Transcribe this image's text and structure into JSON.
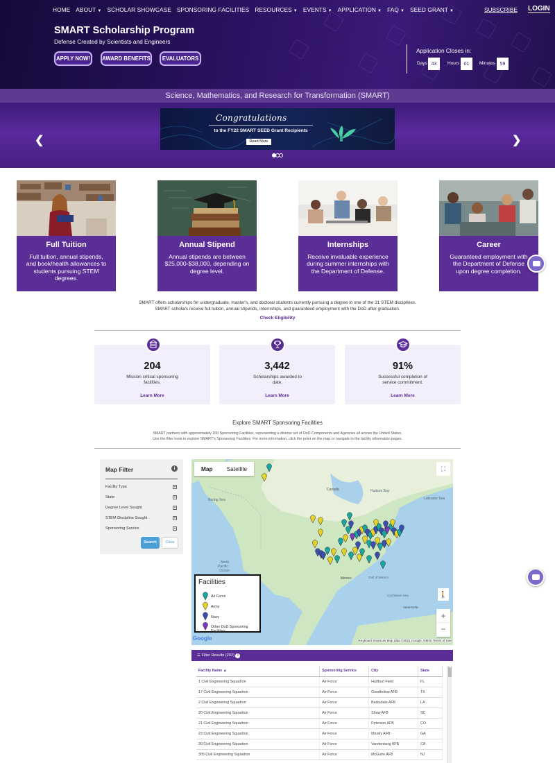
{
  "nav": {
    "items": [
      {
        "label": "HOME",
        "dropdown": false
      },
      {
        "label": "ABOUT",
        "dropdown": true
      },
      {
        "label": "SCHOLAR SHOWCASE",
        "dropdown": false
      },
      {
        "label": "SPONSORING FACILITIES",
        "dropdown": false
      },
      {
        "label": "RESOURCES",
        "dropdown": true
      },
      {
        "label": "EVENTS",
        "dropdown": true
      },
      {
        "label": "APPLICATION",
        "dropdown": true
      },
      {
        "label": "FAQ",
        "dropdown": true
      },
      {
        "label": "SEED GRANT",
        "dropdown": true
      }
    ],
    "subscribe": "SUBSCRIBE",
    "login": "LOGIN"
  },
  "hero": {
    "title": "SMART Scholarship Program",
    "subtitle": "Defense Created by Scientists and Engineers",
    "buttons": [
      "APPLY NOW!",
      "AWARD BENEFITS",
      "EVALUATORS"
    ],
    "countdown": {
      "label": "Application Closes in:",
      "days_label": "Days",
      "days": "43",
      "hours_label": "Hours",
      "hours": "01",
      "minutes_label": "Minutes",
      "minutes": "59"
    }
  },
  "band": "Science, Mathematics, and Research for Transformation (SMART)",
  "carousel": {
    "heading": "Congratulations",
    "text": "to the FY22 SMART SEED Grant Recipients",
    "button": "Read More",
    "active_slide": 1,
    "slide_count": 3
  },
  "cards": [
    {
      "title": "Full Tuition",
      "body": "Full tuition, annual stipends, and book/health allowances to students pursuing STEM degrees."
    },
    {
      "title": "Annual Stipend",
      "body": "Annual stipends are between $25,000-$38,000, depending on degree level."
    },
    {
      "title": "Internships",
      "body": "Receive invaluable experience during summer internships with the Department of Defense."
    },
    {
      "title": "Career",
      "body": "Guaranteed employment with the Department of Defense upon degree completion."
    }
  ],
  "intro": {
    "line1": "SMART offers scholarships for undergraduate, master's, and doctoral students currently pursuing a degree in one of the 21 STEM disciplines.",
    "line2": "SMART scholars receive full tuition, annual stipends, internships, and guaranteed employment with the DoD after graduation.",
    "link": "Check Eligibility"
  },
  "stats": [
    {
      "value": "204",
      "desc": "Mission critical sponsoring facilities.",
      "link": "Learn More"
    },
    {
      "value": "3,442",
      "desc": "Scholarships awarded to date.",
      "link": "Learn More"
    },
    {
      "value": "91%",
      "desc": "Successful completion of service commitment.",
      "link": "Learn More"
    }
  ],
  "explore": {
    "title": "Explore SMART Sponsoring Facilities",
    "line1": "SMART partners with approximately 200 Sponsoring Facilities, representing a diverse set of DoD Components and Agencies all across the United States.",
    "line2": "Use the filter tools to explore SMART's Sponsoring Facilities. For more information, click the point on the map or navigate to the facility information pages."
  },
  "filter": {
    "title": "Map Filter",
    "rows": [
      "Facility Type",
      "State",
      "Degree Level Sought",
      "STEM Discipline Sought",
      "Sponsoring Service"
    ],
    "search": "Search",
    "clear": "Clear"
  },
  "map": {
    "tabs": [
      "Map",
      "Satellite"
    ],
    "labels": {
      "bering": "Bering Sea",
      "canada": "Canada",
      "hudson": "Hudson Bay",
      "labrador": "Labrador Sea",
      "north_pacific": "North Pacific Ocean",
      "mexico": "Mexico",
      "gulf": "Gulf of Mexico",
      "caribbean": "Caribbean Sea",
      "venezuela": "Venezuela"
    },
    "legend": {
      "title": "Facilities",
      "items": [
        {
          "label": "Air Force",
          "color": "#17a7a0"
        },
        {
          "label": "Army",
          "color": "#e6d32a"
        },
        {
          "label": "Navy",
          "color": "#3a50b0"
        },
        {
          "label": "Other DoD Sponsoring Facilities",
          "color": "#7a3dc0"
        }
      ]
    },
    "google": "Google",
    "attribution": "Keyboard shortcuts   Map data ©2021 Google, INEGI   Terms of Use"
  },
  "results": {
    "header": "Filter Results (202)",
    "columns": [
      "Facility Name ▲",
      "Sponsoring Service",
      "City",
      "State"
    ],
    "rows": [
      [
        "1 Civil Engineering Squadron",
        "Air Force",
        "Hurlburt Field",
        "FL"
      ],
      [
        "17 Civil Engineering Squadron",
        "Air Force",
        "Goodfellow AFB",
        "TX"
      ],
      [
        "2 Civil Engineering Squadron",
        "Air Force",
        "Barksdale AFB",
        "LA"
      ],
      [
        "20 Civil Engineering Squadron",
        "Air Force",
        "Shaw AFB",
        "SC"
      ],
      [
        "21 Civil Engineering Squadron",
        "Air Force",
        "Peterson AFB",
        "CO"
      ],
      [
        "23 Civil Engineering Squadron",
        "Air Force",
        "Moody AFB",
        "GA"
      ],
      [
        "30 Civil Engineering Squadron",
        "Air Force",
        "Vandenberg AFB",
        "CA"
      ],
      [
        "305 Civil Engineering Squadron",
        "Air Force",
        "McGuire AFB",
        "NJ"
      ]
    ]
  },
  "colors": {
    "purple": "#5b2d96",
    "nav_bg": "#1e0f4a",
    "link_blue": "#4a9fd6"
  }
}
